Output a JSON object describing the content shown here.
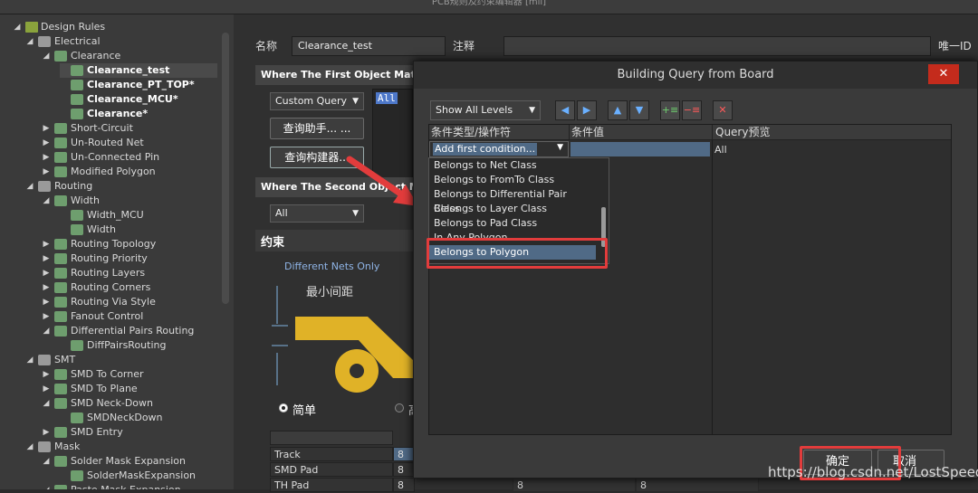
{
  "window": {
    "title": "PCB规则及约束编辑器 [mil]"
  },
  "tree": {
    "root": "Design Rules",
    "items": [
      {
        "label": "Electrical"
      },
      {
        "label": "Clearance"
      },
      {
        "label": "Clearance_test"
      },
      {
        "label": "Clearance_PT_TOP*"
      },
      {
        "label": "Clearance_MCU*"
      },
      {
        "label": "Clearance*"
      },
      {
        "label": "Short-Circuit"
      },
      {
        "label": "Un-Routed Net"
      },
      {
        "label": "Un-Connected Pin"
      },
      {
        "label": "Modified Polygon"
      },
      {
        "label": "Routing"
      },
      {
        "label": "Width"
      },
      {
        "label": "Width_MCU"
      },
      {
        "label": "Width"
      },
      {
        "label": "Routing Topology"
      },
      {
        "label": "Routing Priority"
      },
      {
        "label": "Routing Layers"
      },
      {
        "label": "Routing Corners"
      },
      {
        "label": "Routing Via Style"
      },
      {
        "label": "Fanout Control"
      },
      {
        "label": "Differential Pairs Routing"
      },
      {
        "label": "DiffPairsRouting"
      },
      {
        "label": "SMT"
      },
      {
        "label": "SMD To Corner"
      },
      {
        "label": "SMD To Plane"
      },
      {
        "label": "SMD Neck-Down"
      },
      {
        "label": "SMDNeckDown"
      },
      {
        "label": "SMD Entry"
      },
      {
        "label": "Mask"
      },
      {
        "label": "Solder Mask Expansion"
      },
      {
        "label": "SolderMaskExpansion"
      },
      {
        "label": "Paste Mask Expansion"
      }
    ]
  },
  "rule": {
    "name_label": "名称",
    "name_value": "Clearance_test",
    "comment_label": "注释",
    "comment_value": "",
    "uid_label": "唯一ID",
    "first_match_title": "Where The First Object Matches",
    "first_query_type": "Custom Query",
    "query_text": "All",
    "query_helper_btn": "查询助手... ...",
    "query_builder_btn": "查询构建器...",
    "second_match_title": "Where The Second Object Matches",
    "second_query_type": "All",
    "constraints_title": "约束",
    "diff_nets": "Different Nets Only",
    "min_gap": "最小间距",
    "radio_simple": "简单",
    "radio_advanced": "高",
    "table_rows": [
      {
        "name": "Track",
        "v1": "8"
      },
      {
        "name": "SMD Pad",
        "v1": "8"
      },
      {
        "name": "TH Pad",
        "v1": "8",
        "v2": "8",
        "v3": "8"
      }
    ]
  },
  "dialog": {
    "title": "Building Query from Board",
    "close": "✕",
    "levels": "Show All Levels",
    "col_condition": "条件类型/操作符",
    "col_value": "条件值",
    "col_preview": "Query预览",
    "preview_text": "All",
    "first_condition": "Add first condition...",
    "options": [
      "Belongs to Net Class",
      "Belongs to FromTo Class",
      "Belongs to Differential Pair Class",
      "Belongs to Layer Class",
      "Belongs to Pad Class",
      "In Any Polygon",
      "Belongs to Polygon"
    ],
    "ok": "确定",
    "cancel": "取消"
  },
  "watermark": "https://blog.csdn.net/LostSpeed",
  "colors": {
    "accent_red": "#e23c3c",
    "selection_blue": "#506a86",
    "pad_yellow": "#e0b227"
  }
}
